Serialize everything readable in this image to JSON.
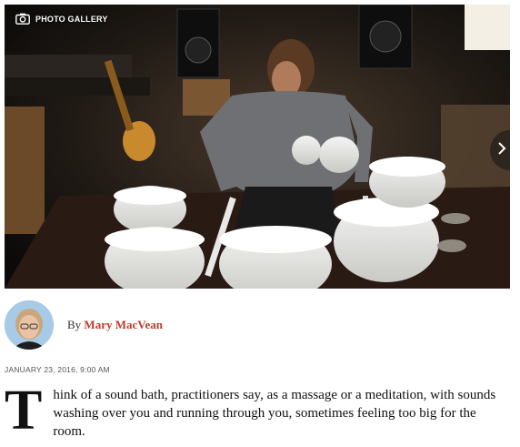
{
  "gallery": {
    "label": "PHOTO GALLERY",
    "icon": "camera-icon",
    "next_icon": "chevron-right-icon",
    "photo_description_icon": "photo"
  },
  "byline": {
    "prefix": "By",
    "author": "Mary MacVean",
    "author_color": "#c0392b"
  },
  "date": "JANUARY 23, 2016, 9:00 AM",
  "article": {
    "dropcap": "T",
    "text": "hink of a sound bath, practitioners say, as a massage or a meditation, with sounds washing over you and running through you, sometimes feeling too big for the room."
  }
}
